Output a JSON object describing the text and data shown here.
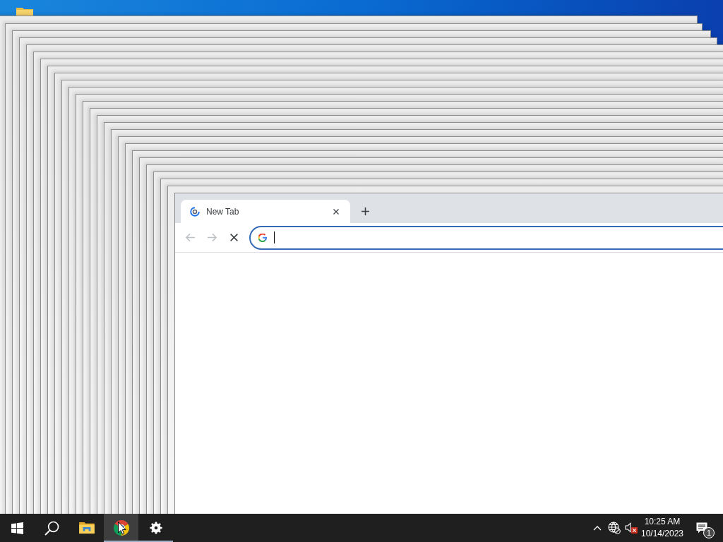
{
  "browser": {
    "tabs": [
      {
        "title": "New Tab",
        "selected": true,
        "loading": true
      }
    ],
    "toolbar": {
      "back_disabled": true,
      "forward_disabled": true,
      "loading": true
    },
    "omnibox": {
      "focused": true
    }
  },
  "taskbar": {
    "buttons": [
      {
        "kind": "start",
        "running": false,
        "selected": false
      },
      {
        "kind": "search",
        "running": false,
        "selected": false
      },
      {
        "kind": "explorer",
        "running": false,
        "selected": false
      },
      {
        "kind": "chrome",
        "running": true,
        "selected": true
      },
      {
        "kind": "settings",
        "running": true,
        "selected": false
      }
    ],
    "tray": {
      "network_connected": false,
      "volume_muted": true,
      "time": "10:25 AM",
      "date": "10/14/2023",
      "notification_count": "1"
    }
  }
}
